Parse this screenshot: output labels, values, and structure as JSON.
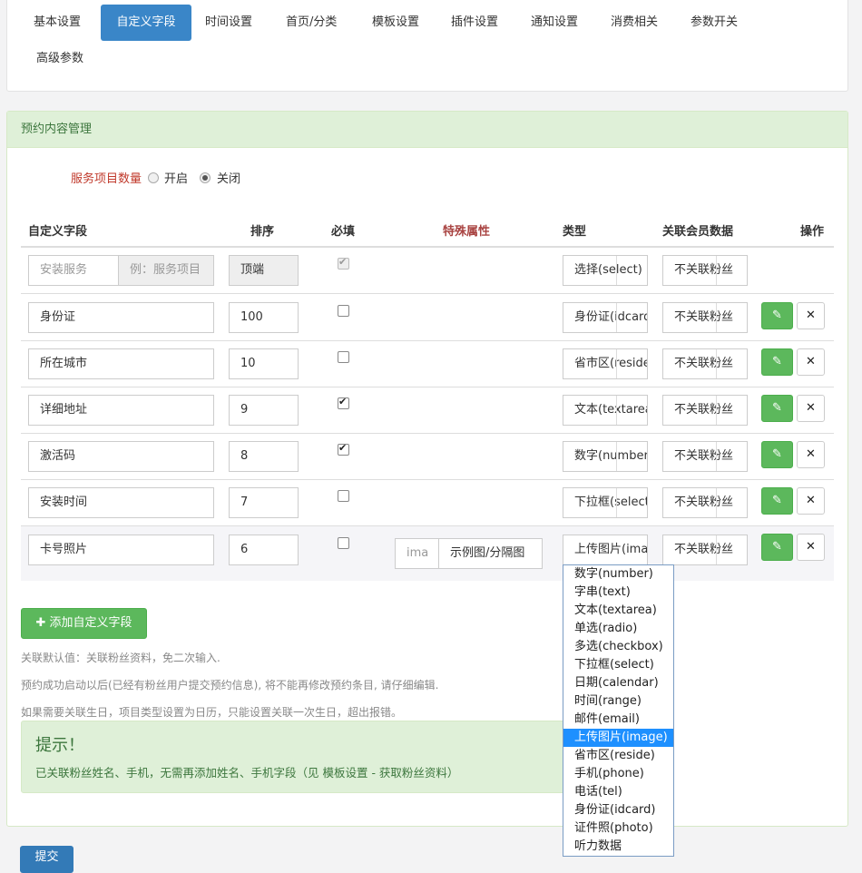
{
  "tabs": [
    "基本设置",
    "自定义字段",
    "时间设置",
    "首页/分类",
    "模板设置",
    "插件设置",
    "通知设置",
    "消费相关",
    "参数开关",
    "高级参数"
  ],
  "active_tab": "自定义字段",
  "panel_title": "预约内容管理",
  "service_count": {
    "label": "服务项目数量",
    "on": "开启",
    "off": "关闭",
    "selected": "关闭"
  },
  "headers": {
    "field": "自定义字段",
    "order": "排序",
    "required": "必填",
    "special": "特殊属性",
    "type": "类型",
    "member": "关联会员数据",
    "action": "操作"
  },
  "first_row": {
    "placeholder": "安装服务",
    "addon": "例：服务项目",
    "order": "顶端",
    "type": "选择(select)",
    "member": "不关联粉丝"
  },
  "rows": [
    {
      "name": "身份证",
      "order": "100",
      "required": false,
      "type": "身份证(idcard)",
      "member": "不关联粉丝"
    },
    {
      "name": "所在城市",
      "order": "10",
      "required": false,
      "type": "省市区(reside)",
      "member": "不关联粉丝"
    },
    {
      "name": "详细地址",
      "order": "9",
      "required": true,
      "type": "文本(textarea)",
      "member": "不关联粉丝"
    },
    {
      "name": "激活码",
      "order": "8",
      "required": true,
      "type": "数字(number)",
      "member": "不关联粉丝"
    },
    {
      "name": "安装时间",
      "order": "7",
      "required": false,
      "type": "下拉框(select)",
      "member": "不关联粉丝"
    },
    {
      "name": "卡号照片",
      "order": "6",
      "required": false,
      "type": "上传图片(image)",
      "member": "不关联粉丝",
      "special_placeholder": "ima",
      "special_addon": "示例图/分隔图"
    }
  ],
  "edit_icon": "edit-icon",
  "delete_icon": "close-icon",
  "dropdown_options": [
    "数字(number)",
    "字串(text)",
    "文本(textarea)",
    "单选(radio)",
    "多选(checkbox)",
    "下拉框(select)",
    "日期(calendar)",
    "时间(range)",
    "邮件(email)",
    "上传图片(image)",
    "省市区(reside)",
    "手机(phone)",
    "电话(tel)",
    "身份证(idcard)",
    "证件照(photo)",
    "听力数据"
  ],
  "dropdown_selected": "上传图片(image)",
  "add_button": "添加自定义字段",
  "notes": [
    "关联默认值：关联粉丝资料，免二次输入.",
    "预约成功启动以后(已经有粉丝用户提交预约信息), 将不能再修改预约条目, 请仔细编辑.",
    "如果需要关联生日，项目类型设置为日历，只能设置关联一次生日，超出报错。"
  ],
  "tip": {
    "title": "提示！",
    "body": "已关联粉丝姓名、手机，无需再添加姓名、手机字段（见 模板设置 - 获取粉丝资料）"
  },
  "submit": "提交",
  "colors": {
    "primary": "#3a86c8",
    "success": "#5cb85c",
    "panel_head": "#dff0d8"
  }
}
